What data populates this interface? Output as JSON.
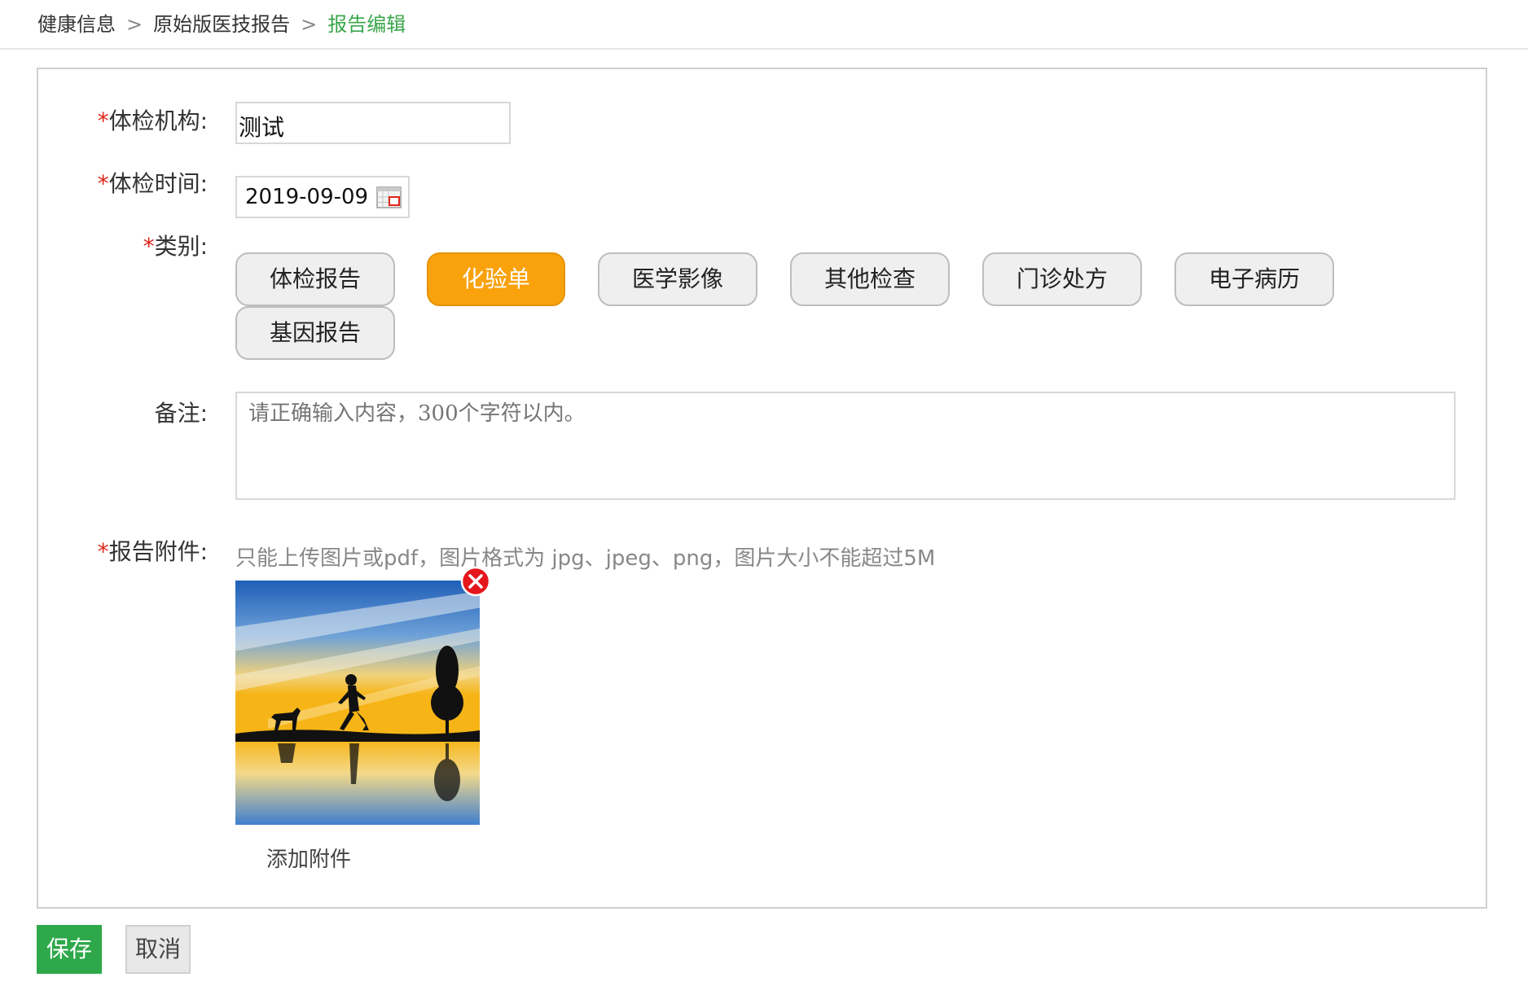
{
  "breadcrumb": {
    "items": [
      "健康信息",
      "原始版医技报告",
      "报告编辑"
    ],
    "separator": ">"
  },
  "form": {
    "institution": {
      "required_mark": "*",
      "label": "体检机构:",
      "value": "测试"
    },
    "exam_date": {
      "required_mark": "*",
      "label": "体检时间:",
      "value": "2019-09-09",
      "icon": "calendar-icon"
    },
    "category": {
      "required_mark": "*",
      "label": "类别:",
      "options": [
        "体检报告",
        "化验单",
        "医学影像",
        "其他检查",
        "门诊处方",
        "电子病历",
        "基因报告"
      ],
      "selected": "化验单"
    },
    "remark": {
      "label": "备注:",
      "placeholder": "请正确输入内容，300个字符以内。",
      "value": ""
    },
    "attachment": {
      "required_mark": "*",
      "label": "报告附件:",
      "hint": "只能上传图片或pdf，图片格式为 jpg、jpeg、png，图片大小不能超过5M",
      "add_label": "添加附件",
      "delete_icon": "close-circle-icon"
    }
  },
  "actions": {
    "save_label": "保存",
    "cancel_label": "取消"
  },
  "colors": {
    "accent_green": "#2ea84a",
    "breadcrumb_current": "#3aa64a",
    "selected_category": "#f9a20c",
    "required_star": "#e0251a",
    "delete_red": "#e5161c"
  }
}
